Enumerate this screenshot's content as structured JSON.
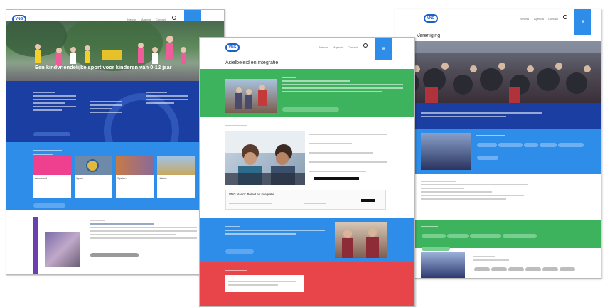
{
  "pages": [
    {
      "logo": "VNG",
      "nav": [
        "Nieuws",
        "Agenda",
        "Contact"
      ],
      "hero_caption": "Een kindvriendelijke sport voor kinderen van 0-12 jaar",
      "cards": [
        "Aandacht",
        "Sport",
        "Spelen",
        "Natuur"
      ],
      "colors": {
        "navy": "#1b3ea3",
        "blue": "#2d8de8",
        "pink": "#ef3f8f"
      }
    },
    {
      "logo": "VNG",
      "nav": [
        "Nieuws",
        "Agenda",
        "Contact"
      ],
      "title": "Asielbeleid en integratie",
      "sub_title": "VNG Naam: Beleid en integratie",
      "colors": {
        "green": "#3db35e",
        "blue": "#2d8de8",
        "red": "#e8454a"
      }
    },
    {
      "logo": "VNG",
      "nav": [
        "Nieuws",
        "Agenda",
        "Contact"
      ],
      "title": "Vereniging",
      "colors": {
        "navy": "#1b3ea3",
        "blue": "#2d8de8",
        "green": "#3db35e"
      }
    }
  ]
}
